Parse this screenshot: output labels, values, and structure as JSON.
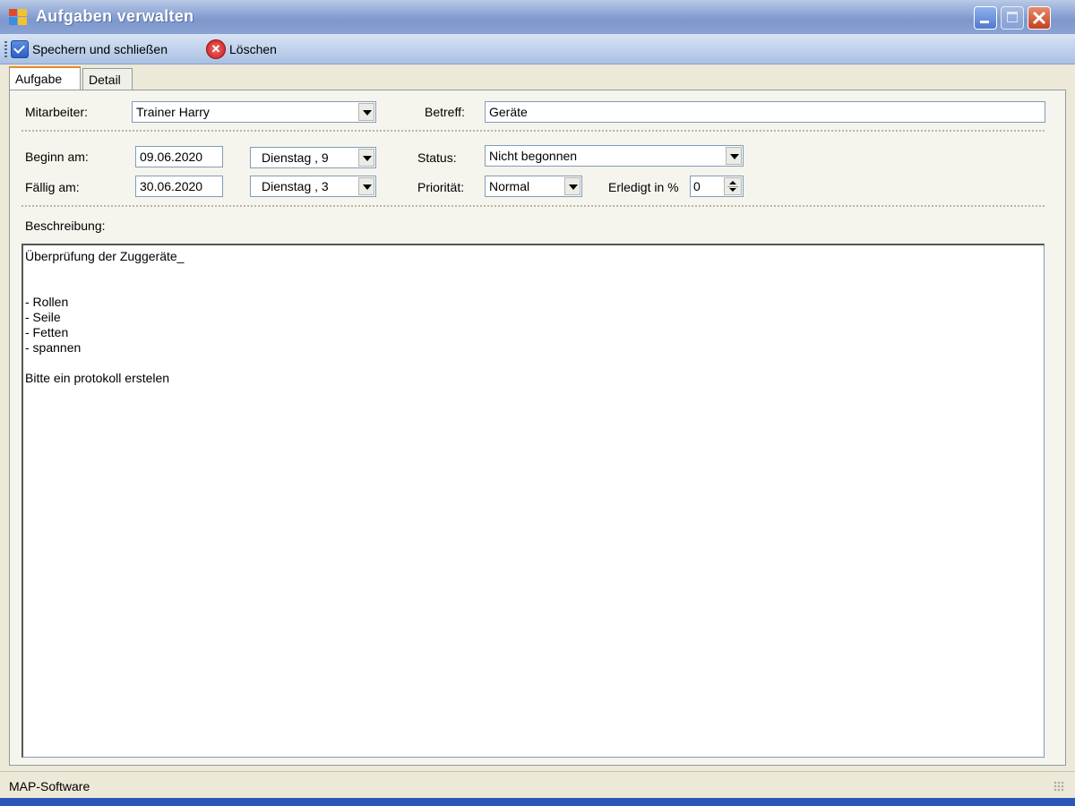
{
  "window": {
    "title": "Aufgaben verwalten"
  },
  "toolbar": {
    "save_label": "Spechern und schließen",
    "delete_label": "Löschen"
  },
  "tabs": [
    {
      "label": "Aufgabe",
      "active": true
    },
    {
      "label": "Detail",
      "active": false
    }
  ],
  "form": {
    "mitarbeiter_label": "Mitarbeiter:",
    "mitarbeiter_value": "Trainer Harry",
    "betreff_label": "Betreff:",
    "betreff_value": "Geräte",
    "beginn_label": "Beginn am:",
    "beginn_value": "09.06.2020",
    "beginn_day": "Dienstag  ,  9",
    "faellig_label": "Fällig am:",
    "faellig_value": "30.06.2020",
    "faellig_day": "Dienstag  ,  3",
    "status_label": "Status:",
    "status_value": "Nicht begonnen",
    "prioritaet_label": "Priorität:",
    "prioritaet_value": "Normal",
    "erledigt_label": "Erledigt in %",
    "erledigt_value": "0",
    "beschreibung_label": "Beschreibung:",
    "beschreibung_value": "Überprüfung der Zuggeräte_\n\n\n- Rollen\n- Seile\n- Fetten\n- spannen\n\nBitte ein protokoll erstelen"
  },
  "statusbar": {
    "text": "MAP-Software"
  },
  "colors": {
    "title_bar": "#8ea7d6",
    "active_tab_accent": "#e68b2c",
    "close_button": "#c2401f"
  }
}
